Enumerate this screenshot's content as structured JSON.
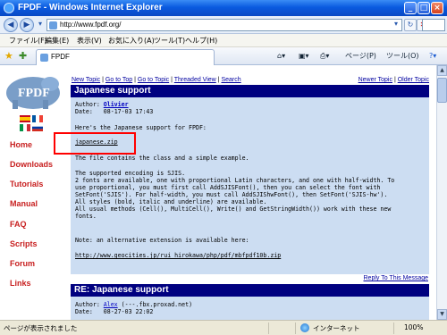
{
  "window": {
    "title": "FPDF - Windows Internet Explorer",
    "buttons": {
      "minimize": "_",
      "maximize": "□",
      "close": "×"
    }
  },
  "addressbar": {
    "url": "http://www.fpdf.org/",
    "icons": [
      "back-icon",
      "forward-icon",
      "dropdown-icon",
      "refresh-icon",
      "stop-icon",
      "search-icon"
    ]
  },
  "menubar": {
    "items": [
      "ファイル(F)",
      "編集(E)",
      "表示(V)",
      "お気に入り(A)",
      "ツール(T)",
      "ヘルプ(H)"
    ]
  },
  "tabbar": {
    "tab_label": "FPDF",
    "commands": {
      "page": "ページ(P)",
      "tools": "ツール(O)"
    }
  },
  "site": {
    "logo_text": "FPDF",
    "nav": [
      "Home",
      "Downloads",
      "Tutorials",
      "Manual",
      "FAQ",
      "Scripts",
      "Forum",
      "Links"
    ],
    "colors": {
      "nav": "#c82020",
      "header": "#000080",
      "post_bg": "#ccddf2"
    }
  },
  "topic": {
    "nav_left": [
      "New Topic",
      "Go to Top",
      "Go to Topic",
      "Threaded View",
      "Search"
    ],
    "nav_right": [
      "Newer Topic",
      "Older Topic"
    ],
    "separator": "|",
    "title": "Japanese support",
    "post": {
      "author_label": "Author: ",
      "author": "Olivier",
      "date_label": "Date:",
      "date": "08-17-03 17:43",
      "intro": "Here's the Japanese support for FPDF:",
      "download_link": "japanese.zip",
      "contains": "The file contains the class and a simple example.",
      "lines": [
        "The supported encoding is SJIS.",
        "2 fonts are available, one with proportional Latin characters, and one with half-width. To",
        "use proportional, you must first call AddSJISFont(), then you can select the font with",
        "SetFont('SJIS'). For half-width, you must call AddSJIShwFont(), then SetFont('SJIS-hw').",
        "All styles (bold, italic and underline) are available.",
        "All usual methods (Cell(), MultiCell(), Write() and GetStringWidth()) work with these new",
        "fonts."
      ],
      "alt_note": "Note: an alternative extension is available here:",
      "alt_link": "http://www.geocities.jp/rui_hirokawa/php/pdf/mbfpdf10b.zip"
    },
    "reply_label": "Reply To This Message",
    "reply": {
      "title": "RE: Japanese support",
      "author_label": "Author: ",
      "author": "Alex",
      "author_host": "(---.fbx.proxad.net)",
      "date_label": "Date:",
      "date": "08-27-03 22:02"
    }
  },
  "statusbar": {
    "text": "ページが表示されました",
    "zone": "インターネット",
    "zoom": "100%"
  }
}
